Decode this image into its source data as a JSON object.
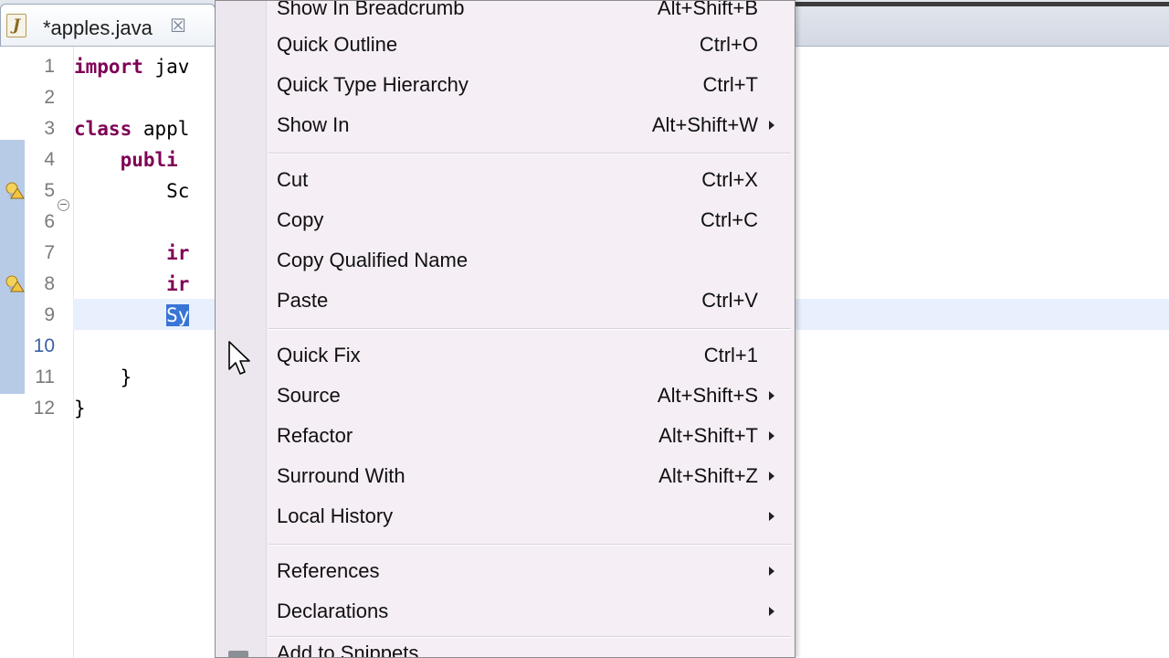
{
  "editor_tab": {
    "icon_letter": "J",
    "title": "*apples.java",
    "close_glyph": "☒"
  },
  "code_lines": [
    {
      "num": "1",
      "parts": [
        {
          "t": "import",
          "kw": true
        },
        {
          "t": " jav"
        }
      ]
    },
    {
      "num": "2",
      "parts": []
    },
    {
      "num": "3",
      "parts": [
        {
          "t": "class",
          "kw": true
        },
        {
          "t": " appl"
        }
      ]
    },
    {
      "num": "4",
      "parts": [
        {
          "t": "    "
        },
        {
          "t": "publi",
          "kw": true
        }
      ]
    },
    {
      "num": "5",
      "parts": [
        {
          "t": "        Sc"
        }
      ]
    },
    {
      "num": "6",
      "parts": []
    },
    {
      "num": "7",
      "parts": [
        {
          "t": "        "
        },
        {
          "t": "ir",
          "kw": true
        }
      ]
    },
    {
      "num": "8",
      "parts": [
        {
          "t": "        "
        },
        {
          "t": "ir",
          "kw": true
        }
      ]
    },
    {
      "num": "9",
      "parts": [
        {
          "t": "        "
        },
        {
          "t": "Sy",
          "sel": true
        }
      ]
    },
    {
      "num": "10",
      "parts": []
    },
    {
      "num": "11",
      "parts": [
        {
          "t": "    }"
        }
      ]
    },
    {
      "num": "12",
      "parts": [
        {
          "t": "}"
        }
      ]
    }
  ],
  "current_line_number": "10",
  "context_menu": {
    "items": [
      {
        "label": "Show In Breadcrumb",
        "accel": "Alt+Shift+B",
        "submenu": false
      },
      {
        "label": "Quick Outline",
        "accel": "Ctrl+O",
        "submenu": false
      },
      {
        "label": "Quick Type Hierarchy",
        "accel": "Ctrl+T",
        "submenu": false
      },
      {
        "label": "Show In",
        "accel": "Alt+Shift+W",
        "submenu": true
      },
      {
        "label": "Cut",
        "accel": "Ctrl+X",
        "submenu": false
      },
      {
        "label": "Copy",
        "accel": "Ctrl+C",
        "submenu": false
      },
      {
        "label": "Copy Qualified Name",
        "accel": "",
        "submenu": false
      },
      {
        "label": "Paste",
        "accel": "Ctrl+V",
        "submenu": false
      },
      {
        "label": "Quick Fix",
        "accel": "Ctrl+1",
        "submenu": false
      },
      {
        "label": "Source",
        "accel": "Alt+Shift+S",
        "submenu": true
      },
      {
        "label": "Refactor",
        "accel": "Alt+Shift+T",
        "submenu": true
      },
      {
        "label": "Surround With",
        "accel": "Alt+Shift+Z",
        "submenu": true
      },
      {
        "label": "Local History",
        "accel": "",
        "submenu": true
      },
      {
        "label": "References",
        "accel": "",
        "submenu": true
      },
      {
        "label": "Declarations",
        "accel": "",
        "submenu": true
      },
      {
        "label": "Add to Snippets...",
        "accel": "",
        "submenu": false
      }
    ]
  }
}
